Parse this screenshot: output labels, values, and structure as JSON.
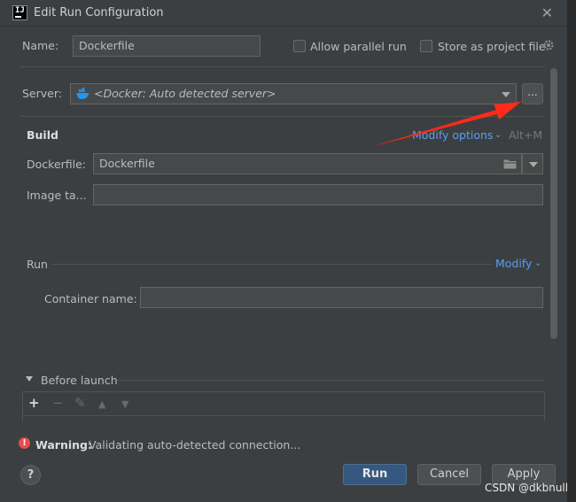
{
  "window": {
    "title": "Edit Run Configuration"
  },
  "config": {
    "name_label": "Name:",
    "name_value": "Dockerfile",
    "allow_parallel_label": "Allow parallel run",
    "store_project_label": "Store as project file"
  },
  "server": {
    "label": "Server:",
    "value": "<Docker: Auto detected server>",
    "more_label": "..."
  },
  "build": {
    "heading": "Build",
    "modify_options_label": "Modify options",
    "shortcut": "Alt+M",
    "dockerfile_label": "Dockerfile:",
    "dockerfile_value": "Dockerfile",
    "image_tag_label": "Image ta..."
  },
  "run": {
    "heading": "Run",
    "modify_label": "Modify",
    "container_name_label": "Container name:"
  },
  "before_launch": {
    "label": "Before launch",
    "toolbar": [
      "+",
      "−",
      "✎",
      "▲",
      "▼"
    ]
  },
  "status": {
    "warning_prefix": "Warning:",
    "warning_text": "Validating auto-detected connection..."
  },
  "buttons": {
    "help": "?",
    "run": "Run",
    "cancel": "Cancel",
    "apply": "Apply"
  },
  "watermark": "CSDN @dkbnull",
  "colors": {
    "accent_link": "#589df6",
    "primary_button": "#365880",
    "warning": "#e74c4c",
    "annotation_arrow": "#ff2a1a"
  }
}
